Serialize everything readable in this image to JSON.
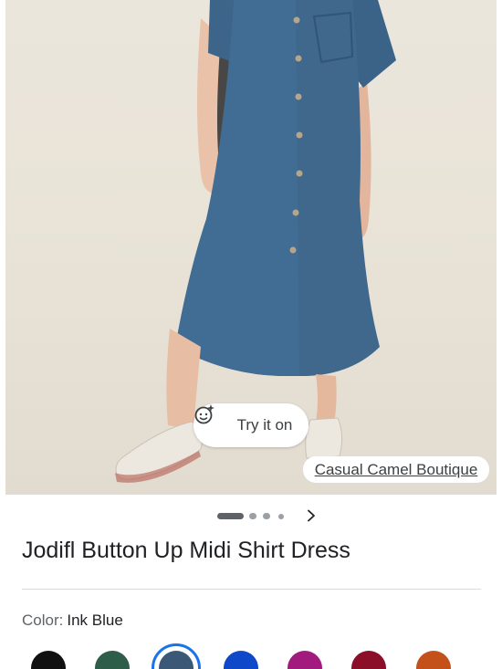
{
  "product": {
    "title": "Jodifl Button Up Midi Shirt Dress",
    "merchant": "Casual Camel Boutique",
    "try_on_label": "Try it on"
  },
  "color": {
    "label": "Color:",
    "selected": "Ink Blue"
  },
  "gallery": {
    "total_dots": 4,
    "active_index": 0
  },
  "swatches": [
    {
      "name": "Black",
      "hex": "#111111"
    },
    {
      "name": "Green",
      "hex": "#2e5e4a"
    },
    {
      "name": "Ink Blue",
      "hex": "#3b5876",
      "selected": true
    },
    {
      "name": "Royal Blue",
      "hex": "#0f48c8"
    },
    {
      "name": "Magenta",
      "hex": "#a21a7e"
    },
    {
      "name": "Burgundy",
      "hex": "#8c0f2a"
    },
    {
      "name": "Rust",
      "hex": "#c4501a"
    }
  ],
  "icons": {
    "try_on": "face-sparkle-icon",
    "next": "chevron-right-icon"
  }
}
